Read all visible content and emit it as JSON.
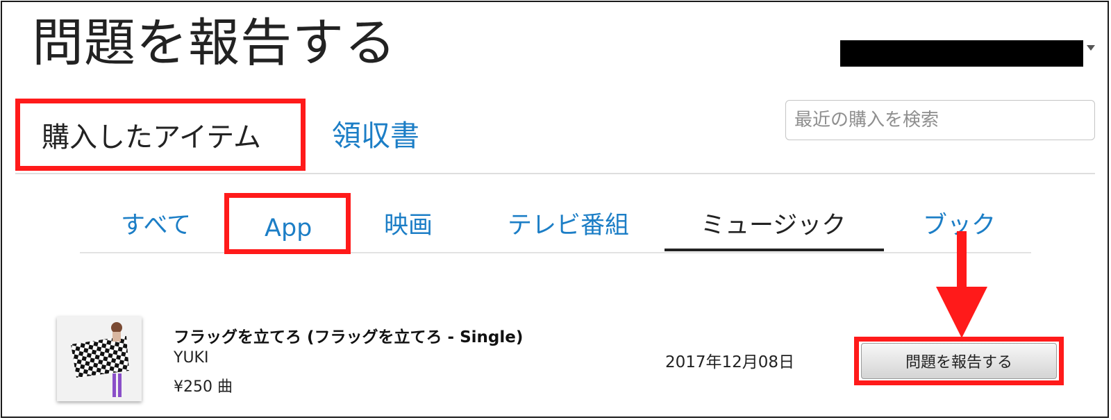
{
  "header": {
    "title": "問題を報告する",
    "account_menu_icon": "chevron-down-icon"
  },
  "tabs": {
    "purchased": "購入したアイテム",
    "receipts": "領収書"
  },
  "search": {
    "placeholder": "最近の購入を検索",
    "value": ""
  },
  "categories": {
    "items": [
      "すべて",
      "App",
      "映画",
      "テレビ番組",
      "ミュージック",
      "ブック"
    ],
    "active": "ミュージック"
  },
  "purchase": {
    "title": "フラッグを立てろ (フラッグを立てろ - Single)",
    "artist": "YUKI",
    "price": "¥250 曲",
    "date": "2017年12月08日",
    "button_label": "問題を報告する"
  },
  "colors": {
    "link_blue": "#1c7ec6",
    "annotation_red": "#ff1a1a",
    "text_dark": "#222222"
  }
}
